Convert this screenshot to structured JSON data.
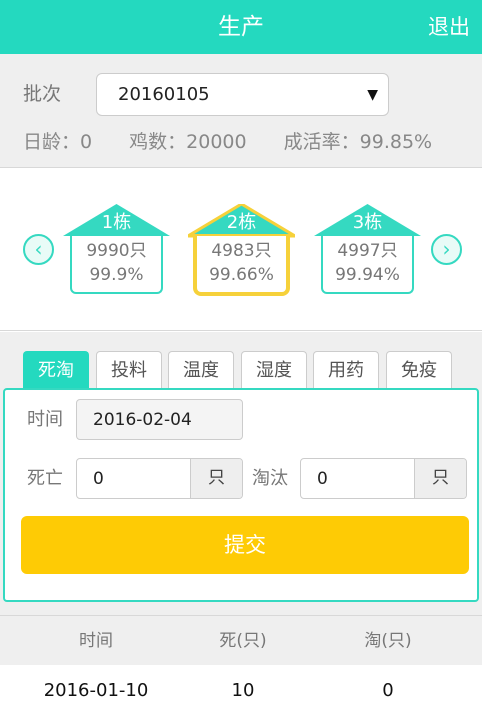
{
  "header": {
    "title": "生产",
    "logout": "退出"
  },
  "batch": {
    "label": "批次",
    "value": "20160105",
    "stats": [
      "日龄：0",
      "鸡数：20000",
      "成活率：99.85%"
    ]
  },
  "houses": [
    {
      "name": "1栋",
      "count": "9990只",
      "rate": "99.9%"
    },
    {
      "name": "2栋",
      "count": "4983只",
      "rate": "99.66%"
    },
    {
      "name": "3栋",
      "count": "4997只",
      "rate": "99.94%"
    }
  ],
  "tabs": [
    "死淘",
    "投料",
    "温度",
    "湿度",
    "用药",
    "免疫"
  ],
  "form": {
    "time_label": "时间",
    "time_value": "2016-02-04",
    "death_label": "死亡",
    "death_value": "0",
    "cull_label": "淘汰",
    "cull_value": "0",
    "unit": "只",
    "submit": "提交"
  },
  "table": {
    "headers": [
      "时间",
      "死(只)",
      "淘(只)"
    ],
    "rows": [
      [
        "2016-01-10",
        "10",
        "0"
      ]
    ]
  }
}
